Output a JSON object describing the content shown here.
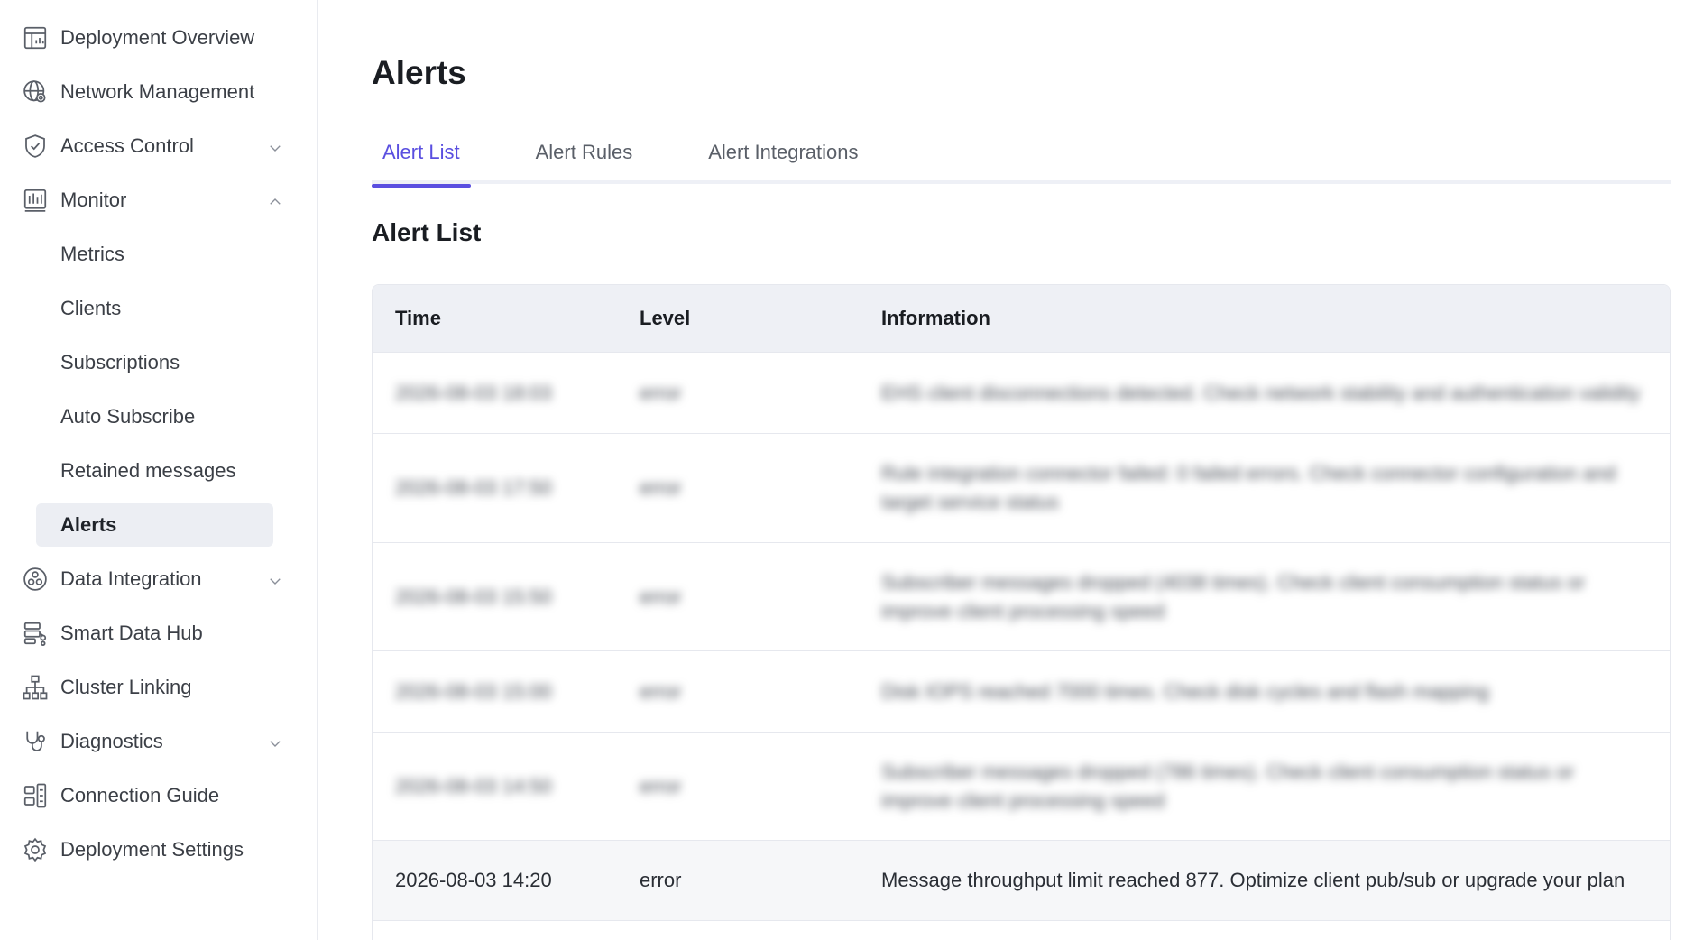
{
  "sidebar": {
    "items": [
      {
        "label": "Deployment Overview",
        "icon": "dashboard-icon"
      },
      {
        "label": "Network Management",
        "icon": "globe-settings-icon"
      },
      {
        "label": "Access Control",
        "icon": "shield-check-icon",
        "chevron": "down"
      },
      {
        "label": "Monitor",
        "icon": "bar-chart-icon",
        "chevron": "up"
      },
      {
        "label": "Data Integration",
        "icon": "data-integration-icon",
        "chevron": "down"
      },
      {
        "label": "Smart Data Hub",
        "icon": "data-hub-icon"
      },
      {
        "label": "Cluster Linking",
        "icon": "hierarchy-icon"
      },
      {
        "label": "Diagnostics",
        "icon": "stethoscope-icon",
        "chevron": "down"
      },
      {
        "label": "Connection Guide",
        "icon": "connection-guide-icon"
      },
      {
        "label": "Deployment Settings",
        "icon": "gear-icon"
      }
    ],
    "monitor_subitems": [
      "Metrics",
      "Clients",
      "Subscriptions",
      "Auto Subscribe",
      "Retained messages",
      "Alerts"
    ],
    "active_subitem": "Alerts"
  },
  "main": {
    "title": "Alerts",
    "tabs": [
      "Alert List",
      "Alert Rules",
      "Alert Integrations"
    ],
    "active_tab": "Alert List",
    "section_title": "Alert List",
    "table": {
      "headers": [
        "Time",
        "Level",
        "Information"
      ],
      "blurred_rows": [
        {
          "time": "2026-08-03 18:03",
          "level": "error",
          "info": "EHS client disconnections detected. Check network stability and authentication validity"
        },
        {
          "time": "2026-08-03 17:50",
          "level": "error",
          "info": "Rule integration connector failed: 0 failed errors. Check connector configuration and target service status"
        },
        {
          "time": "2026-08-03 15:50",
          "level": "error",
          "info": "Subscriber messages dropped (4038 times). Check client consumption status or improve client processing speed"
        },
        {
          "time": "2026-08-03 15:00",
          "level": "error",
          "info": "Disk IOPS reached 7000 times. Check disk cycles and flash mapping"
        },
        {
          "time": "2026-08-03 14:50",
          "level": "error",
          "info": "Subscriber messages dropped (786 times). Check client consumption status or improve client processing speed"
        }
      ],
      "visible_row": {
        "time": "2026-08-03 14:20",
        "level": "error",
        "info": "Message throughput limit reached 877. Optimize client pub/sub or upgrade your plan"
      }
    }
  },
  "colors": {
    "accent": "#5a4fe0",
    "active_bg": "#eceef3",
    "header_bg": "#eef0f5"
  }
}
